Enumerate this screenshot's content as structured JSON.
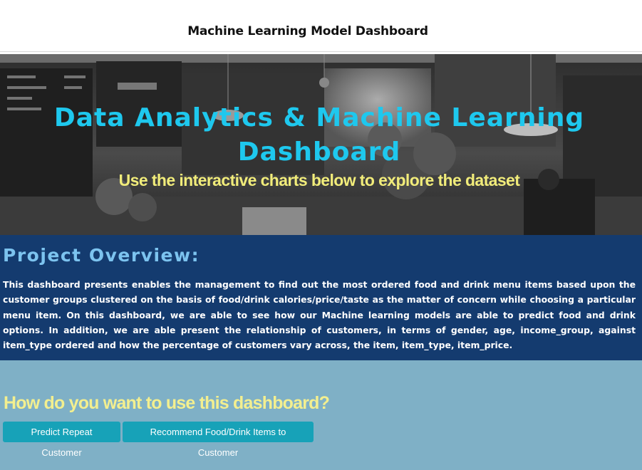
{
  "app": {
    "title": "Machine Learning Model Dashboard"
  },
  "hero": {
    "title": "Data Analytics & Machine Learning Dashboard",
    "subtitle": "Use the interactive charts below to explore the dataset",
    "title_color": "#1ec8ee",
    "subtitle_color": "#f1ec7a",
    "background": "grayscale cafe photo"
  },
  "overview": {
    "heading": "Project Overview:",
    "text": "This dashboard presents enables the management to find out the most ordered food and drink menu items based upon the customer groups clustered on the basis of food/drink calories/price/taste as the matter of concern while choosing a particular menu item. On this dashboard, we are able to see how our Machine learning models are able to predict food and drink options. In addition, we are able present the relationship of customers, in terms of gender, age, income_group, against item_type ordered and how the percentage of customers vary across, the item, item_type, item_price.",
    "background": "#143b6f"
  },
  "usage": {
    "heading": "How do you want to use this dashboard?",
    "background": "#7fb0c6",
    "buttons": {
      "predict": "Predict Repeat Customer",
      "recommend": "Recommend Food/Drink Items to Customer"
    },
    "button_color": "#17a2b8"
  }
}
